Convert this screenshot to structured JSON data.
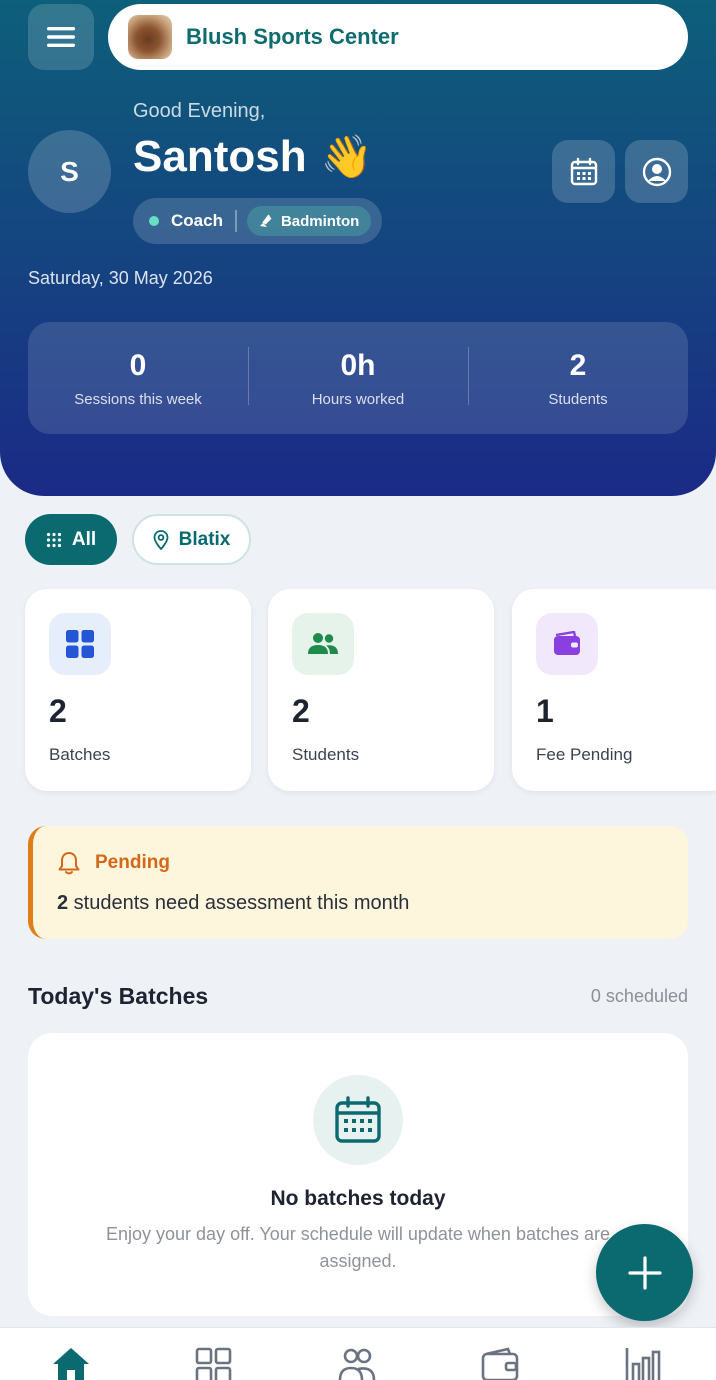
{
  "header": {
    "center_name": "Blush Sports Center",
    "greeting": "Good Evening,",
    "user_name": "Santosh",
    "wave_emoji": "👋",
    "avatar_initial": "S",
    "role": "Coach",
    "sport": "Badminton",
    "date": "Saturday, 30 May 2026"
  },
  "stats": [
    {
      "value": "0",
      "label": "Sessions this week"
    },
    {
      "value": "0h",
      "label": "Hours worked"
    },
    {
      "value": "2",
      "label": "Students"
    }
  ],
  "filters": {
    "all_label": "All",
    "location_label": "Blatix"
  },
  "metrics": [
    {
      "value": "2",
      "label": "Batches",
      "icon": "grid-icon",
      "icon_bg": "#e6edfb",
      "icon_color": "#2456d6"
    },
    {
      "value": "2",
      "label": "Students",
      "icon": "users-icon",
      "icon_bg": "#e5f3ea",
      "icon_color": "#1f8a4c"
    },
    {
      "value": "1",
      "label": "Fee Pending",
      "icon": "wallet-icon",
      "icon_bg": "#f1e8fb",
      "icon_color": "#8a3fe0"
    }
  ],
  "alert": {
    "title": "Pending",
    "count": "2",
    "message": " students need assessment this month"
  },
  "batches": {
    "title": "Today's Batches",
    "meta": "0 scheduled",
    "empty_title": "No batches today",
    "empty_text": "Enjoy your day off. Your schedule will update when batches are assigned."
  },
  "colors": {
    "accent": "#0b6a70",
    "header_top": "#0d5f7a",
    "header_bottom": "#1b2a86",
    "alert_orange": "#e07d1b"
  },
  "bottom_nav": [
    "home-icon",
    "grid-icon",
    "users-icon",
    "wallet-icon",
    "bar-chart-icon"
  ]
}
